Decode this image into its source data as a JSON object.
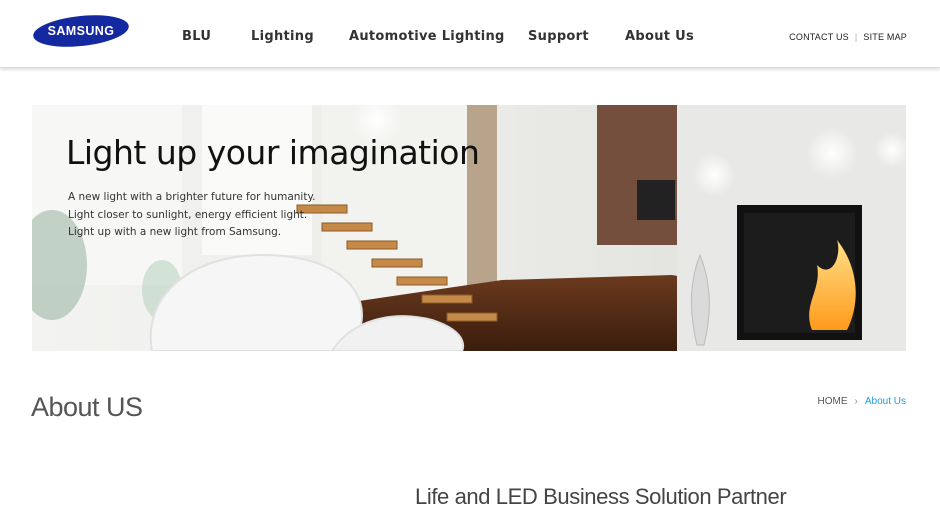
{
  "header": {
    "logo_text": "SAMSUNG",
    "nav": [
      {
        "label": "BLU"
      },
      {
        "label": "Lighting"
      },
      {
        "label": "Automotive Lighting"
      },
      {
        "label": "Support"
      },
      {
        "label": "About Us"
      }
    ],
    "util": {
      "contact": "CONTACT US",
      "sitemap": "SITE MAP",
      "separator": "|"
    },
    "brand_color": "#1428a0"
  },
  "hero": {
    "title": "Light up your imagination",
    "lines": [
      "A new light with a brighter future for humanity.",
      "Light closer to sunlight, energy efficient light.",
      "Light up with a new light from Samsung."
    ]
  },
  "page": {
    "title": "About US",
    "breadcrumb": {
      "home": "HOME",
      "current": "About Us",
      "current_color": "#1aa0d8"
    },
    "section_heading": "Life and LED Business Solution Partner"
  }
}
